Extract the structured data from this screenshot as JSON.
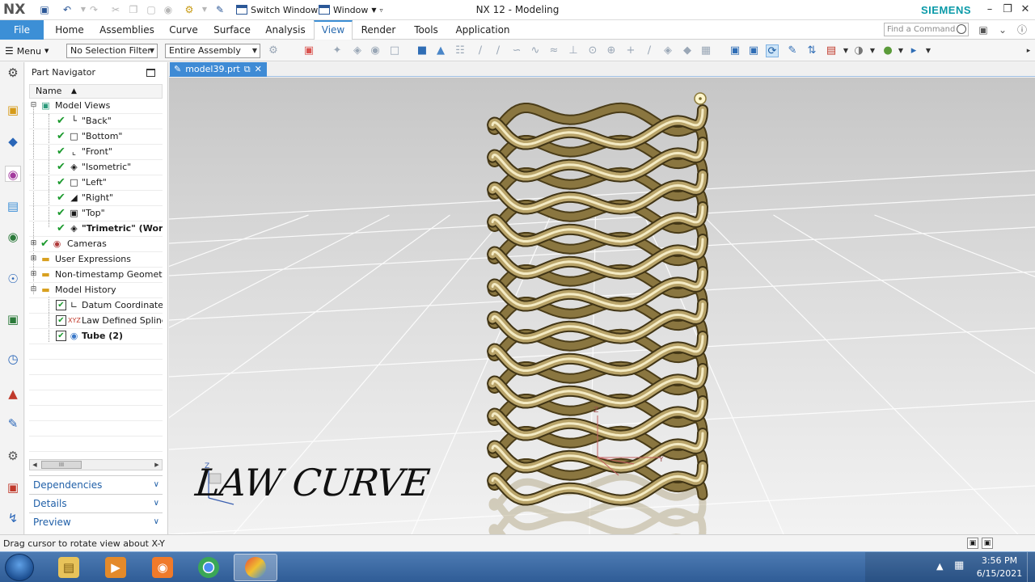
{
  "titlebar": {
    "logo": "NX",
    "switch_window": "Switch Window",
    "window_menu": "Window",
    "app_title": "NX 12 - Modeling",
    "brand": "SIEMENS"
  },
  "ribbon": {
    "file": "File",
    "tabs": [
      {
        "label": "Home"
      },
      {
        "label": "Assemblies"
      },
      {
        "label": "Curve"
      },
      {
        "label": "Surface"
      },
      {
        "label": "Analysis"
      },
      {
        "label": "View",
        "active": true
      },
      {
        "label": "Render"
      },
      {
        "label": "Tools"
      },
      {
        "label": "Application"
      }
    ],
    "find_command_placeholder": "Find a Command"
  },
  "toolbar": {
    "menu": "Menu",
    "selection_filter": "No Selection Filter",
    "scope": "Entire Assembly"
  },
  "navigator": {
    "title": "Part Navigator",
    "column_name": "Name",
    "items": [
      {
        "label": "Model Views"
      },
      {
        "label": "\"Back\""
      },
      {
        "label": "\"Bottom\""
      },
      {
        "label": "\"Front\""
      },
      {
        "label": "\"Isometric\""
      },
      {
        "label": "\"Left\""
      },
      {
        "label": "\"Right\""
      },
      {
        "label": "\"Top\""
      },
      {
        "label": "\"Trimetric\" (Worl"
      },
      {
        "label": "Cameras"
      },
      {
        "label": "User Expressions"
      },
      {
        "label": "Non-timestamp Geometr"
      },
      {
        "label": "Model History"
      },
      {
        "label": "Datum Coordinate"
      },
      {
        "label": "Law Defined Spline"
      },
      {
        "label": "Tube (2)"
      }
    ],
    "panels": [
      "Dependencies",
      "Details",
      "Preview"
    ]
  },
  "document": {
    "tab_label": "model39.prt",
    "overlay_text": "LAW CURVE",
    "axis_labels": {
      "z": "Z",
      "y": "Y"
    }
  },
  "status": {
    "text": "Drag cursor to rotate view about X-Y"
  },
  "taskbar": {
    "time": "3:56 PM",
    "date": "6/15/2021"
  },
  "colors": {
    "accent": "#3c8fd6",
    "brand": "#0a9aa8",
    "tube_gold": "#b9a46a",
    "check_green": "#1c9a2e"
  }
}
